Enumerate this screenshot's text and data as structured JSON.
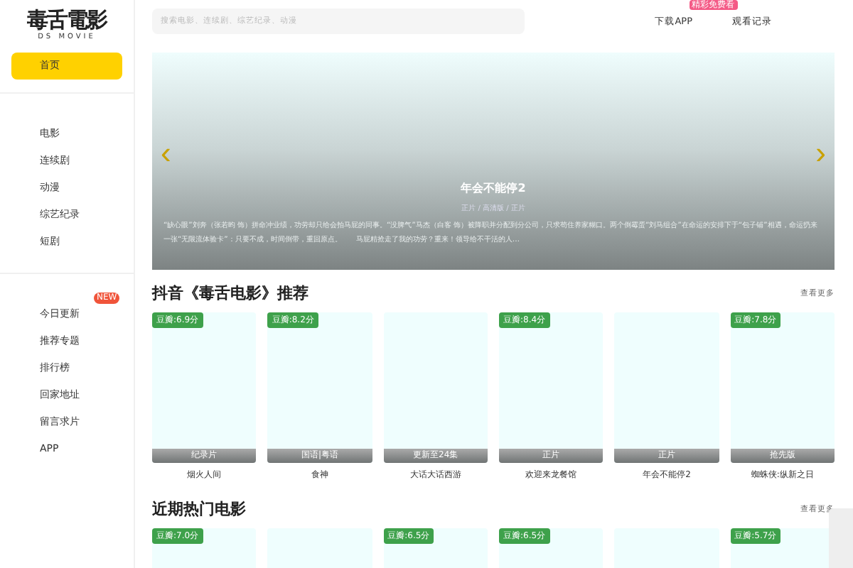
{
  "logo": {
    "title": "毒舌電影",
    "subtitle": "DS MOVIE"
  },
  "sidebar": {
    "groups": [
      {
        "items": [
          {
            "label": "首页",
            "selected": true
          }
        ]
      },
      {
        "items": [
          {
            "label": "电影",
            "selected": false
          },
          {
            "label": "连续剧",
            "selected": false
          },
          {
            "label": "动漫",
            "selected": false
          },
          {
            "label": "综艺纪录",
            "selected": false
          },
          {
            "label": "短剧",
            "selected": false
          }
        ]
      },
      {
        "items": [
          {
            "label": "今日更新",
            "selected": false,
            "badge": "NEW"
          },
          {
            "label": "推荐专题",
            "selected": false
          },
          {
            "label": "排行榜",
            "selected": false
          },
          {
            "label": "回家地址",
            "selected": false
          },
          {
            "label": "留言求片",
            "selected": false
          },
          {
            "label": "APP",
            "selected": false
          }
        ]
      }
    ]
  },
  "search": {
    "placeholder": "搜索电影、连续剧、综艺纪录、动漫"
  },
  "header_links": [
    {
      "label": "下载APP",
      "badge": "精彩免费看"
    },
    {
      "label": "观看记录"
    }
  ],
  "banner": {
    "prev": "‹",
    "next": "›",
    "title": "年会不能停2",
    "meta": "正片 / 高清版 / 正片",
    "description": "“缺心眼”刘奔（张若昀 饰）拼命冲业绩，功劳却只给会拍马屁的同事。“没脾气”马杰（白客 饰）被降职并分配到分公司，只求苟住养家糊口。两个倒霉蛋“刘马组合”在命运的安排下于“包子铺”相遇，命运扔来一张“无限流体验卡”：只要不成，时间倒带，重回原点。　　马屁精抢走了我的功劳？重来！领导给不干活的人…"
  },
  "sections": [
    {
      "title": "抖音《毒舌电影》推荐",
      "more": "查看更多",
      "movies": [
        {
          "kind": "poster",
          "rating": "豆瓣:6.9分",
          "tag": "纪录片",
          "name": "烟火人间"
        },
        {
          "kind": "poster",
          "rating": "豆瓣:8.2分",
          "tag": "国语|粤语",
          "name": "食神"
        },
        {
          "kind": "poster",
          "tag": "更新至24集",
          "name": "大话大话西游"
        },
        {
          "kind": "poster",
          "rating": "豆瓣:8.4分",
          "tag": "正片",
          "name": "欢迎来龙餐馆"
        },
        {
          "kind": "poster",
          "tag": "正片",
          "name": "年会不能停2"
        },
        {
          "kind": "poster",
          "rating": "豆瓣:7.8分",
          "tag": "抢先版",
          "name": "蜘蛛侠:纵新之日"
        }
      ]
    },
    {
      "title": "近期热门电影",
      "more": "查看更多",
      "movies": [
        {
          "kind": "poster",
          "rating": "豆瓣:7.0分"
        },
        {
          "kind": "poster"
        },
        {
          "kind": "poster",
          "rating": "豆瓣:6.5分"
        },
        {
          "kind": "poster",
          "rating": "豆瓣:6.5分"
        },
        {
          "kind": "poster"
        },
        {
          "kind": "poster",
          "rating": "豆瓣:5.7分"
        }
      ]
    }
  ]
}
